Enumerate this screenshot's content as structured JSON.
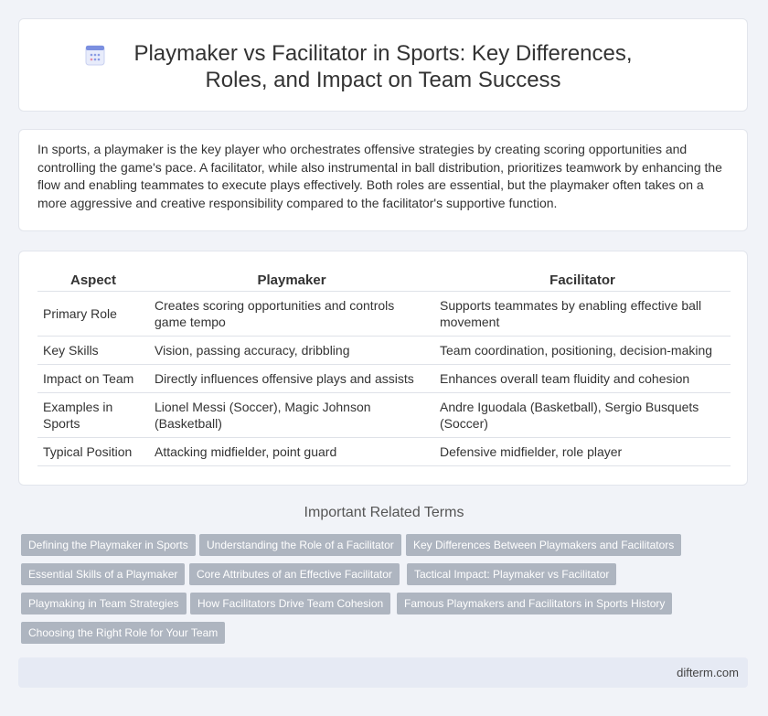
{
  "header": {
    "title": "Playmaker vs Facilitator in Sports: Key Differences, Roles, and Impact on Team Success",
    "icon": "document-icon"
  },
  "intro": {
    "text": "In sports, a playmaker is the key player who orchestrates offensive strategies by creating scoring opportunities and controlling the game's pace. A facilitator, while also instrumental in ball distribution, prioritizes teamwork by enhancing the flow and enabling teammates to execute plays effectively. Both roles are essential, but the playmaker often takes on a more aggressive and creative responsibility compared to the facilitator's supportive function."
  },
  "table": {
    "headers": [
      "Aspect",
      "Playmaker",
      "Facilitator"
    ],
    "rows": [
      [
        "Primary Role",
        "Creates scoring opportunities and controls game tempo",
        "Supports teammates by enabling effective ball movement"
      ],
      [
        "Key Skills",
        "Vision, passing accuracy, dribbling",
        "Team coordination, positioning, decision-making"
      ],
      [
        "Impact on Team",
        "Directly influences offensive plays and assists",
        "Enhances overall team fluidity and cohesion"
      ],
      [
        "Examples in Sports",
        "Lionel Messi (Soccer), Magic Johnson (Basketball)",
        "Andre Iguodala (Basketball), Sergio Busquets (Soccer)"
      ],
      [
        "Typical Position",
        "Attacking midfielder, point guard",
        "Defensive midfielder, role player"
      ]
    ]
  },
  "related": {
    "title": "Important Related Terms",
    "tags": [
      "Defining the Playmaker in Sports",
      "Understanding the Role of a Facilitator",
      "Key Differences Between Playmakers and Facilitators",
      "Essential Skills of a Playmaker",
      "Core Attributes of an Effective Facilitator",
      "Tactical Impact: Playmaker vs Facilitator",
      "Playmaking in Team Strategies",
      "How Facilitators Drive Team Cohesion",
      "Famous Playmakers and Facilitators in Sports History",
      "Choosing the Right Role for Your Team"
    ]
  },
  "footer": {
    "site": "difterm.com"
  }
}
